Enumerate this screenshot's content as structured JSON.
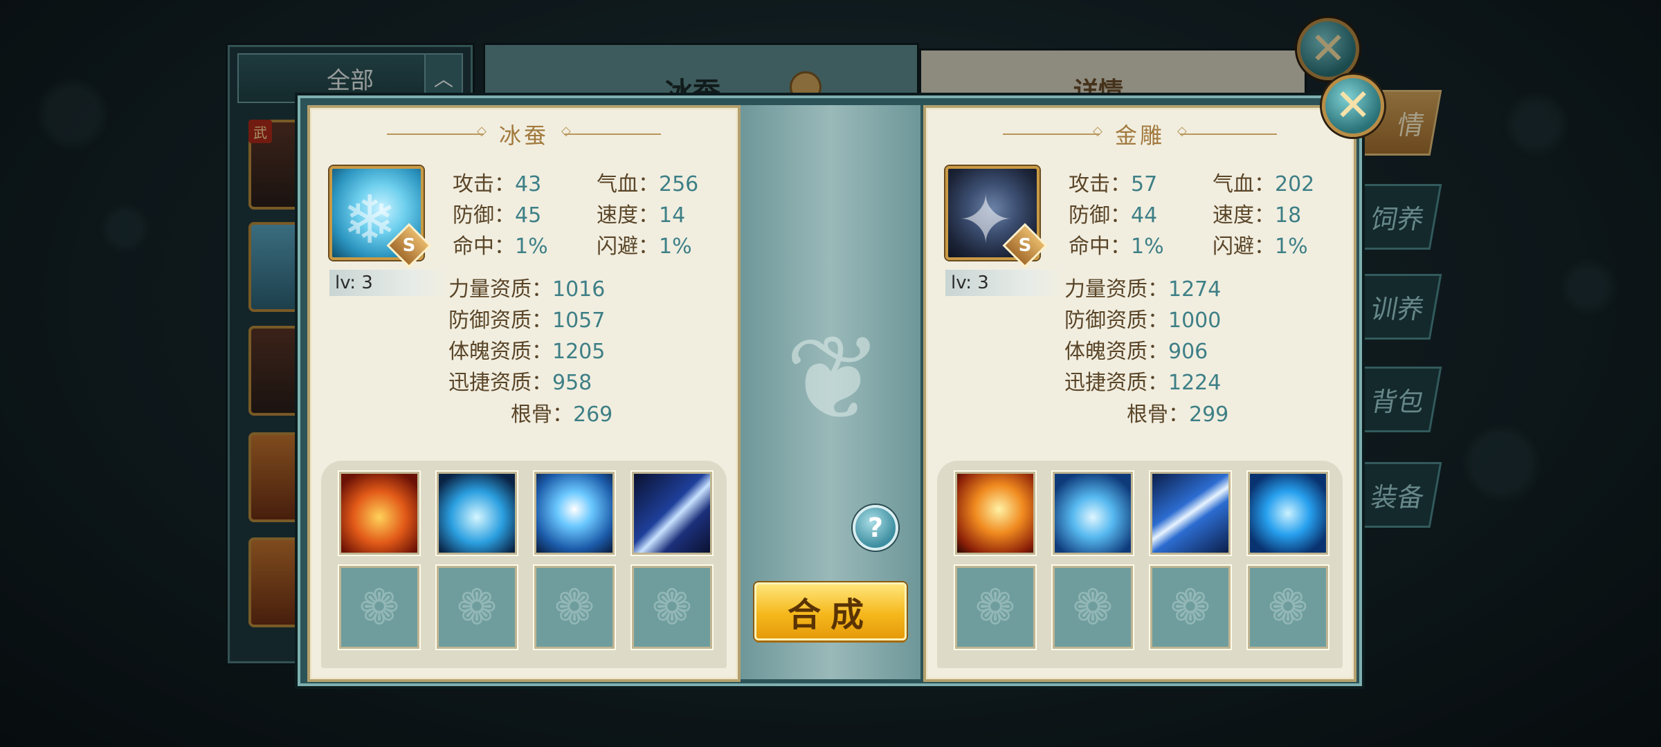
{
  "background": {
    "list_header": "全部",
    "list_toggle": "︿",
    "list_badge": "武",
    "center_title": "冰蚕",
    "right_title": "详情",
    "side_tabs": [
      "情",
      "饲养",
      "训养",
      "背包",
      "装备"
    ]
  },
  "close_glyph": "✕",
  "left_pet": {
    "name": "冰蚕",
    "rank": "S",
    "level": "lv: 3",
    "stats": [
      {
        "label": "攻击：",
        "value": "43"
      },
      {
        "label": "气血：",
        "value": "256"
      },
      {
        "label": "防御：",
        "value": "45"
      },
      {
        "label": "速度：",
        "value": "14"
      },
      {
        "label": "命中：",
        "value": "1%"
      },
      {
        "label": "闪避：",
        "value": "1%"
      }
    ],
    "aptitudes": [
      {
        "label": "力量资质：",
        "value": "1016"
      },
      {
        "label": "防御资质：",
        "value": "1057"
      },
      {
        "label": "体魄资质：",
        "value": "1205"
      },
      {
        "label": "迅捷资质：",
        "value": "958"
      },
      {
        "label": "根骨：",
        "value": "269"
      }
    ],
    "skills": [
      "fire-skill-icon",
      "blue-orb-skill-icon",
      "lightning-skill-icon",
      "claw-skill-icon"
    ]
  },
  "right_pet": {
    "name": "金雕",
    "rank": "S",
    "level": "lv: 3",
    "stats": [
      {
        "label": "攻击：",
        "value": "57"
      },
      {
        "label": "气血：",
        "value": "202"
      },
      {
        "label": "防御：",
        "value": "44"
      },
      {
        "label": "速度：",
        "value": "18"
      },
      {
        "label": "命中：",
        "value": "1%"
      },
      {
        "label": "闪避：",
        "value": "1%"
      }
    ],
    "aptitudes": [
      {
        "label": "力量资质：",
        "value": "1274"
      },
      {
        "label": "防御资质：",
        "value": "1000"
      },
      {
        "label": "体魄资质：",
        "value": "906"
      },
      {
        "label": "迅捷资质：",
        "value": "1224"
      },
      {
        "label": "根骨：",
        "value": "299"
      }
    ],
    "skills": [
      "phoenix-skill-icon",
      "heart-skill-icon",
      "bolt-skill-icon",
      "wolf-skill-icon"
    ]
  },
  "help_label": "?",
  "merge_label": "合成",
  "colors": {
    "stat_value": "#3e7f86",
    "stat_label": "#5a4528",
    "title_gold": "#a27a3e",
    "button_gold": "#f5b81c"
  }
}
